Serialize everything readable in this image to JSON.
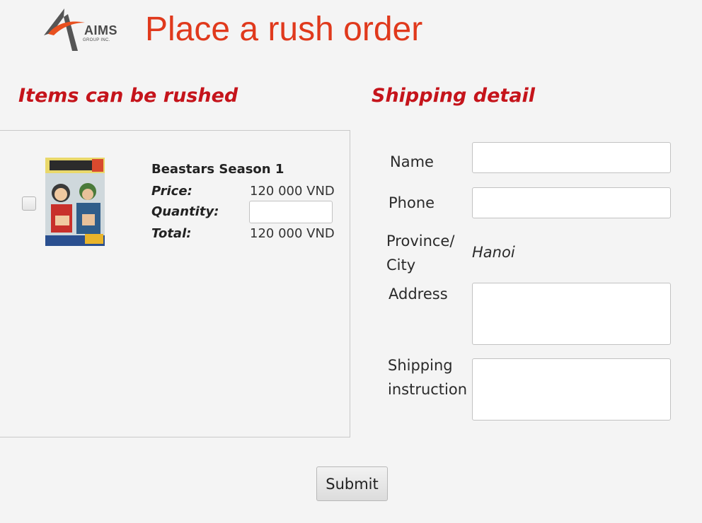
{
  "header": {
    "logo_text": "AIMS",
    "logo_subtext": "GROUP INC.",
    "title": "Place a rush order"
  },
  "items_section": {
    "title": "Items can be rushed",
    "items": [
      {
        "name": "Beastars Season 1",
        "price_label": "Price:",
        "price_value": "120 000 VND",
        "quantity_label": "Quantity:",
        "quantity_value": "",
        "total_label": "Total:",
        "total_value": "120 000 VND",
        "checked": false
      }
    ]
  },
  "shipping_section": {
    "title": "Shipping detail",
    "name_label": "Name",
    "name_value": "",
    "phone_label": "Phone",
    "phone_value": "",
    "province_label_line1": "Province/",
    "province_label_line2": "City",
    "province_value": "Hanoi",
    "address_label": "Address",
    "address_value": "",
    "instruction_label_line1": "Shipping",
    "instruction_label_line2": "instruction",
    "instruction_value": ""
  },
  "actions": {
    "submit_label": "Submit"
  },
  "colors": {
    "page_title": "#e0391c",
    "section_title": "#c5141b",
    "background": "#f4f4f4",
    "logo_orange": "#e8501f",
    "logo_gray": "#555555"
  }
}
